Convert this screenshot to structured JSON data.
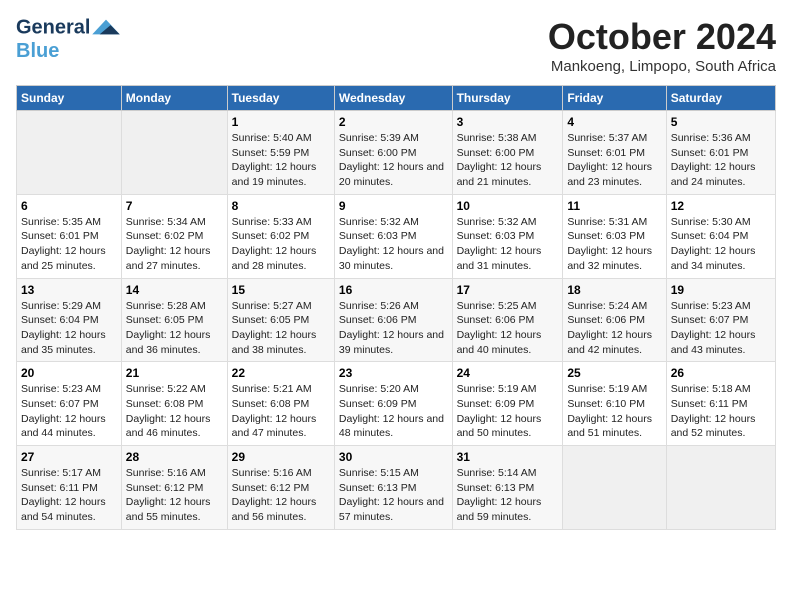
{
  "header": {
    "logo_line1": "General",
    "logo_line2": "Blue",
    "month": "October 2024",
    "location": "Mankoeng, Limpopo, South Africa"
  },
  "weekdays": [
    "Sunday",
    "Monday",
    "Tuesday",
    "Wednesday",
    "Thursday",
    "Friday",
    "Saturday"
  ],
  "weeks": [
    [
      {
        "day": null
      },
      {
        "day": null
      },
      {
        "day": 1,
        "sunrise": "5:40 AM",
        "sunset": "5:59 PM",
        "daylight": "12 hours and 19 minutes."
      },
      {
        "day": 2,
        "sunrise": "5:39 AM",
        "sunset": "6:00 PM",
        "daylight": "12 hours and 20 minutes."
      },
      {
        "day": 3,
        "sunrise": "5:38 AM",
        "sunset": "6:00 PM",
        "daylight": "12 hours and 21 minutes."
      },
      {
        "day": 4,
        "sunrise": "5:37 AM",
        "sunset": "6:01 PM",
        "daylight": "12 hours and 23 minutes."
      },
      {
        "day": 5,
        "sunrise": "5:36 AM",
        "sunset": "6:01 PM",
        "daylight": "12 hours and 24 minutes."
      }
    ],
    [
      {
        "day": 6,
        "sunrise": "5:35 AM",
        "sunset": "6:01 PM",
        "daylight": "12 hours and 25 minutes."
      },
      {
        "day": 7,
        "sunrise": "5:34 AM",
        "sunset": "6:02 PM",
        "daylight": "12 hours and 27 minutes."
      },
      {
        "day": 8,
        "sunrise": "5:33 AM",
        "sunset": "6:02 PM",
        "daylight": "12 hours and 28 minutes."
      },
      {
        "day": 9,
        "sunrise": "5:32 AM",
        "sunset": "6:03 PM",
        "daylight": "12 hours and 30 minutes."
      },
      {
        "day": 10,
        "sunrise": "5:32 AM",
        "sunset": "6:03 PM",
        "daylight": "12 hours and 31 minutes."
      },
      {
        "day": 11,
        "sunrise": "5:31 AM",
        "sunset": "6:03 PM",
        "daylight": "12 hours and 32 minutes."
      },
      {
        "day": 12,
        "sunrise": "5:30 AM",
        "sunset": "6:04 PM",
        "daylight": "12 hours and 34 minutes."
      }
    ],
    [
      {
        "day": 13,
        "sunrise": "5:29 AM",
        "sunset": "6:04 PM",
        "daylight": "12 hours and 35 minutes."
      },
      {
        "day": 14,
        "sunrise": "5:28 AM",
        "sunset": "6:05 PM",
        "daylight": "12 hours and 36 minutes."
      },
      {
        "day": 15,
        "sunrise": "5:27 AM",
        "sunset": "6:05 PM",
        "daylight": "12 hours and 38 minutes."
      },
      {
        "day": 16,
        "sunrise": "5:26 AM",
        "sunset": "6:06 PM",
        "daylight": "12 hours and 39 minutes."
      },
      {
        "day": 17,
        "sunrise": "5:25 AM",
        "sunset": "6:06 PM",
        "daylight": "12 hours and 40 minutes."
      },
      {
        "day": 18,
        "sunrise": "5:24 AM",
        "sunset": "6:06 PM",
        "daylight": "12 hours and 42 minutes."
      },
      {
        "day": 19,
        "sunrise": "5:23 AM",
        "sunset": "6:07 PM",
        "daylight": "12 hours and 43 minutes."
      }
    ],
    [
      {
        "day": 20,
        "sunrise": "5:23 AM",
        "sunset": "6:07 PM",
        "daylight": "12 hours and 44 minutes."
      },
      {
        "day": 21,
        "sunrise": "5:22 AM",
        "sunset": "6:08 PM",
        "daylight": "12 hours and 46 minutes."
      },
      {
        "day": 22,
        "sunrise": "5:21 AM",
        "sunset": "6:08 PM",
        "daylight": "12 hours and 47 minutes."
      },
      {
        "day": 23,
        "sunrise": "5:20 AM",
        "sunset": "6:09 PM",
        "daylight": "12 hours and 48 minutes."
      },
      {
        "day": 24,
        "sunrise": "5:19 AM",
        "sunset": "6:09 PM",
        "daylight": "12 hours and 50 minutes."
      },
      {
        "day": 25,
        "sunrise": "5:19 AM",
        "sunset": "6:10 PM",
        "daylight": "12 hours and 51 minutes."
      },
      {
        "day": 26,
        "sunrise": "5:18 AM",
        "sunset": "6:11 PM",
        "daylight": "12 hours and 52 minutes."
      }
    ],
    [
      {
        "day": 27,
        "sunrise": "5:17 AM",
        "sunset": "6:11 PM",
        "daylight": "12 hours and 54 minutes."
      },
      {
        "day": 28,
        "sunrise": "5:16 AM",
        "sunset": "6:12 PM",
        "daylight": "12 hours and 55 minutes."
      },
      {
        "day": 29,
        "sunrise": "5:16 AM",
        "sunset": "6:12 PM",
        "daylight": "12 hours and 56 minutes."
      },
      {
        "day": 30,
        "sunrise": "5:15 AM",
        "sunset": "6:13 PM",
        "daylight": "12 hours and 57 minutes."
      },
      {
        "day": 31,
        "sunrise": "5:14 AM",
        "sunset": "6:13 PM",
        "daylight": "12 hours and 59 minutes."
      },
      {
        "day": null
      },
      {
        "day": null
      }
    ]
  ]
}
